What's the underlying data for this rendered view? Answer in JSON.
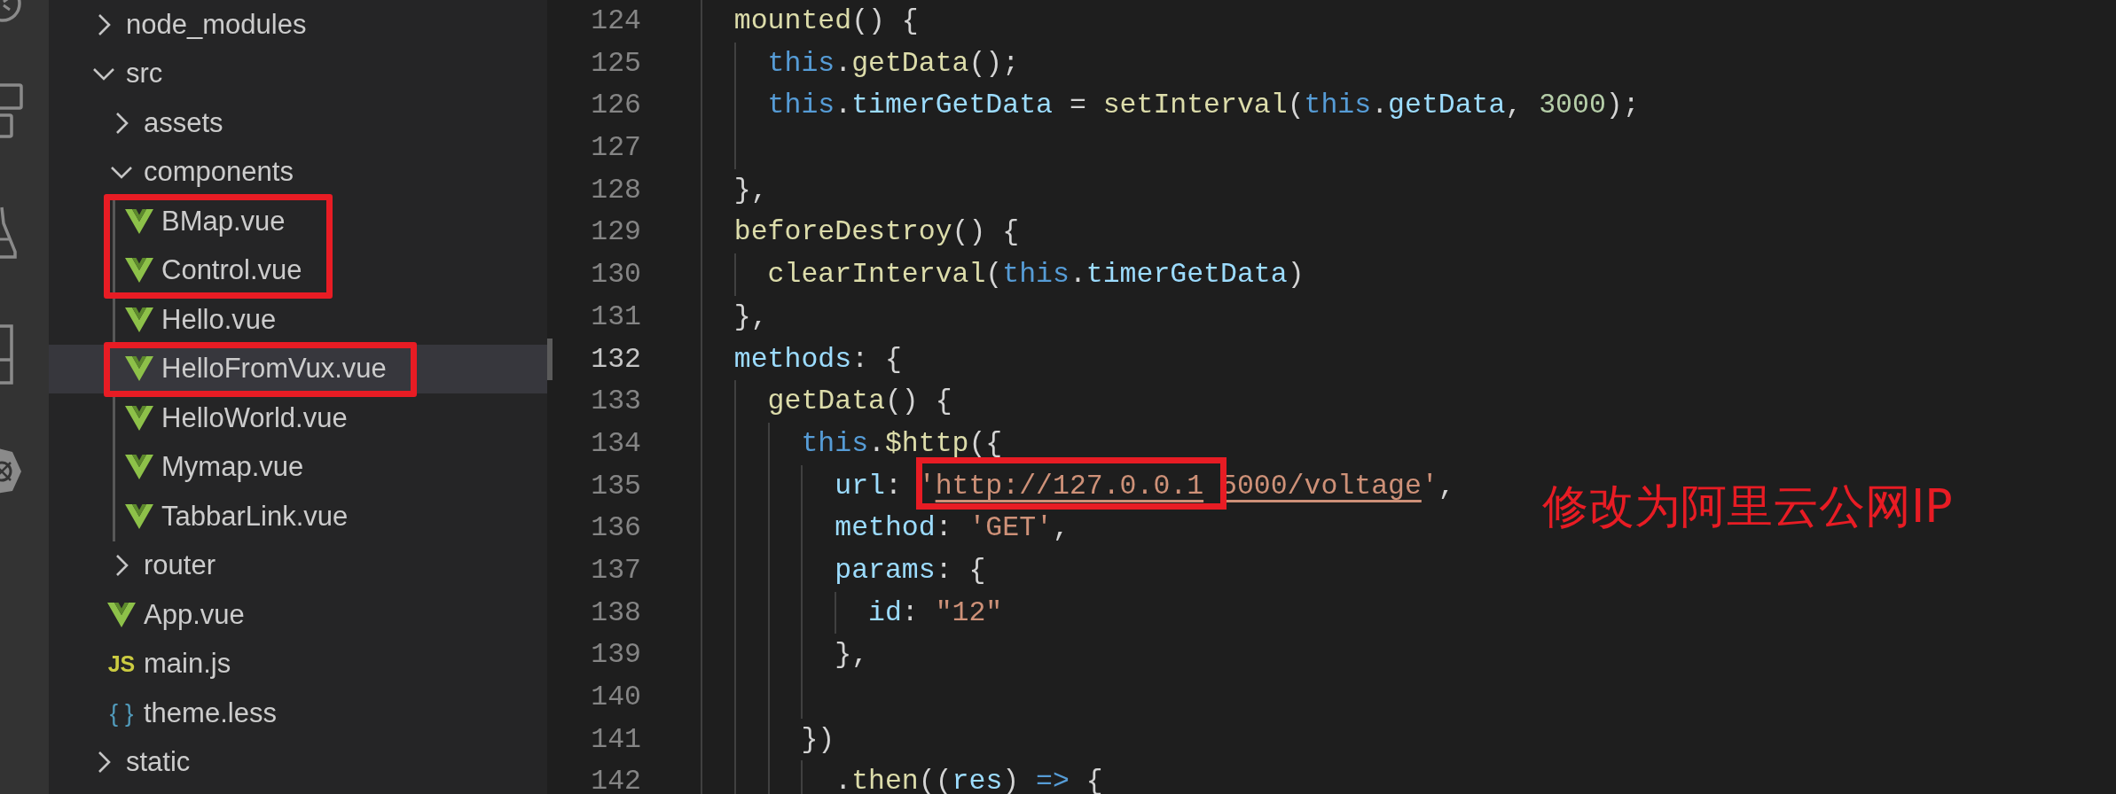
{
  "explorer": {
    "tree": [
      {
        "label": "node_modules",
        "kind": "folder",
        "expanded": false,
        "selected": false,
        "boxed": false
      },
      {
        "label": "src",
        "kind": "folder",
        "expanded": true,
        "selected": false,
        "boxed": false,
        "children": [
          {
            "label": "assets",
            "kind": "folder",
            "expanded": false,
            "selected": false,
            "boxed": false
          },
          {
            "label": "components",
            "kind": "folder",
            "expanded": true,
            "selected": false,
            "boxed": false,
            "children": [
              {
                "label": "BMap.vue",
                "kind": "vue",
                "selected": false,
                "boxed": true
              },
              {
                "label": "Control.vue",
                "kind": "vue",
                "selected": false,
                "boxed": true
              },
              {
                "label": "Hello.vue",
                "kind": "vue",
                "selected": false,
                "boxed": false
              },
              {
                "label": "HelloFromVux.vue",
                "kind": "vue",
                "selected": true,
                "boxed": true
              },
              {
                "label": "HelloWorld.vue",
                "kind": "vue",
                "selected": false,
                "boxed": false
              },
              {
                "label": "Mymap.vue",
                "kind": "vue",
                "selected": false,
                "boxed": false
              },
              {
                "label": "TabbarLink.vue",
                "kind": "vue",
                "selected": false,
                "boxed": false
              }
            ]
          },
          {
            "label": "router",
            "kind": "folder",
            "expanded": false,
            "selected": false,
            "boxed": false
          },
          {
            "label": "App.vue",
            "kind": "vue",
            "selected": false,
            "boxed": false
          },
          {
            "label": "main.js",
            "kind": "js",
            "badge": "JS",
            "selected": false,
            "boxed": false
          },
          {
            "label": "theme.less",
            "kind": "less",
            "badge": "{ }",
            "selected": false,
            "boxed": false
          }
        ]
      },
      {
        "label": "static",
        "kind": "folder",
        "expanded": false,
        "selected": false,
        "boxed": false
      }
    ]
  },
  "editor": {
    "lines": [
      {
        "number": "124",
        "current": false,
        "tokens": [
          {
            "text": "  mounted",
            "kind": "fn"
          },
          {
            "text": "() {",
            "kind": "plain"
          }
        ]
      },
      {
        "number": "125",
        "current": false,
        "tokens": [
          {
            "text": "    this",
            "kind": "kw"
          },
          {
            "text": ".",
            "kind": "plain"
          },
          {
            "text": "getData",
            "kind": "fn"
          },
          {
            "text": "();",
            "kind": "plain"
          }
        ]
      },
      {
        "number": "126",
        "current": false,
        "tokens": [
          {
            "text": "    this",
            "kind": "kw"
          },
          {
            "text": ".",
            "kind": "plain"
          },
          {
            "text": "timerGetData",
            "kind": "prop"
          },
          {
            "text": " = ",
            "kind": "plain"
          },
          {
            "text": "setInterval",
            "kind": "fn"
          },
          {
            "text": "(",
            "kind": "plain"
          },
          {
            "text": "this",
            "kind": "kw"
          },
          {
            "text": ".",
            "kind": "plain"
          },
          {
            "text": "getData",
            "kind": "prop"
          },
          {
            "text": ", ",
            "kind": "plain"
          },
          {
            "text": "3000",
            "kind": "num"
          },
          {
            "text": ");",
            "kind": "plain"
          }
        ]
      },
      {
        "number": "127",
        "current": false
      },
      {
        "number": "128",
        "current": false,
        "tokens": [
          {
            "text": "  },",
            "kind": "plain"
          }
        ]
      },
      {
        "number": "129",
        "current": false,
        "tokens": [
          {
            "text": "  beforeDestroy",
            "kind": "fn"
          },
          {
            "text": "() {",
            "kind": "plain"
          }
        ]
      },
      {
        "number": "130",
        "current": false,
        "tokens": [
          {
            "text": "    clearInterval",
            "kind": "fn"
          },
          {
            "text": "(",
            "kind": "plain"
          },
          {
            "text": "this",
            "kind": "kw"
          },
          {
            "text": ".",
            "kind": "plain"
          },
          {
            "text": "timerGetData",
            "kind": "prop"
          },
          {
            "text": ")",
            "kind": "plain"
          }
        ]
      },
      {
        "number": "131",
        "current": false,
        "tokens": [
          {
            "text": "  },",
            "kind": "plain"
          }
        ]
      },
      {
        "number": "132",
        "current": true,
        "tokens": [
          {
            "text": "  methods",
            "kind": "prop"
          },
          {
            "text": ": {",
            "kind": "plain"
          }
        ]
      },
      {
        "number": "133",
        "current": false,
        "tokens": [
          {
            "text": "    getData",
            "kind": "fn"
          },
          {
            "text": "() {",
            "kind": "plain"
          }
        ]
      },
      {
        "number": "134",
        "current": false,
        "tokens": [
          {
            "text": "      this",
            "kind": "kw"
          },
          {
            "text": ".",
            "kind": "plain"
          },
          {
            "text": "$http",
            "kind": "fn"
          },
          {
            "text": "({",
            "kind": "plain"
          }
        ]
      },
      {
        "number": "135",
        "current": false,
        "tokens": [
          {
            "text": "        url",
            "kind": "prop"
          },
          {
            "text": ": ",
            "kind": "plain"
          },
          {
            "text": "'",
            "kind": "str",
            "boxed": true
          },
          {
            "text": "http://127.0.0.1",
            "kind": "url",
            "boxed": true
          },
          {
            "text": "5000/voltage",
            "kind": "url"
          },
          {
            "text": "'",
            "kind": "str"
          },
          {
            "text": ",",
            "kind": "plain"
          }
        ]
      },
      {
        "number": "136",
        "current": false,
        "tokens": [
          {
            "text": "        method",
            "kind": "prop"
          },
          {
            "text": ": ",
            "kind": "plain"
          },
          {
            "text": "'GET'",
            "kind": "str"
          },
          {
            "text": ",",
            "kind": "plain"
          }
        ]
      },
      {
        "number": "137",
        "current": false,
        "tokens": [
          {
            "text": "        params",
            "kind": "prop"
          },
          {
            "text": ": {",
            "kind": "plain"
          }
        ]
      },
      {
        "number": "138",
        "current": false,
        "tokens": [
          {
            "text": "          id",
            "kind": "prop"
          },
          {
            "text": ": ",
            "kind": "plain"
          },
          {
            "text": "\"12\"",
            "kind": "str"
          }
        ]
      },
      {
        "number": "139",
        "current": false,
        "tokens": [
          {
            "text": "        },",
            "kind": "plain"
          }
        ]
      },
      {
        "number": "140",
        "current": false
      },
      {
        "number": "141",
        "current": false,
        "tokens": [
          {
            "text": "      })",
            "kind": "plain"
          }
        ]
      },
      {
        "number": "142",
        "current": false,
        "tokens": [
          {
            "text": "        .",
            "kind": "plain"
          },
          {
            "text": "then",
            "kind": "fn"
          },
          {
            "text": "((",
            "kind": "plain"
          },
          {
            "text": "res",
            "kind": "prop"
          },
          {
            "text": ") ",
            "kind": "plain"
          },
          {
            "text": "=>",
            "kind": "kw"
          },
          {
            "text": " {",
            "kind": "plain"
          }
        ]
      }
    ],
    "note": "修改为阿里云公网IP"
  }
}
